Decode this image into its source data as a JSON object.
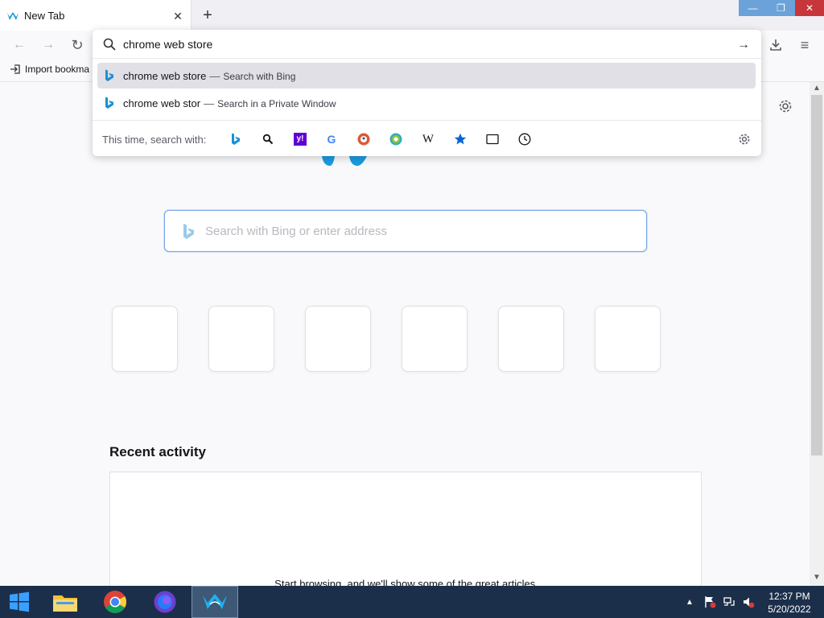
{
  "window": {
    "tab_title": "New Tab",
    "tab_close": "✕",
    "new_tab": "+",
    "minimize": "—",
    "maximize": "❐",
    "close": "✕"
  },
  "toolbar": {
    "back": "←",
    "forward": "→",
    "reload": "↻",
    "downloads": "download-icon",
    "menu": "≡"
  },
  "bookmarks": {
    "import_label": "Import bookma"
  },
  "urlbar": {
    "value": "chrome web store",
    "go": "→",
    "suggestions": [
      {
        "text": "chrome web store",
        "sep": "—",
        "action": "Search with Bing",
        "selected": true
      },
      {
        "text": "chrome web stor",
        "sep": "—",
        "action": "Search in a Private Window",
        "selected": false
      }
    ],
    "one_off_label": "This time, search with:",
    "engines": [
      "bing-icon",
      "search-icon",
      "yahoo-icon",
      "google-icon",
      "duckduckgo-icon",
      "ecosia-icon",
      "wikipedia-icon",
      "bookmarks-icon",
      "tabs-icon",
      "history-icon"
    ],
    "yahoo_text": "y!",
    "google_text": "G",
    "wikipedia_text": "W"
  },
  "content": {
    "search_placeholder": "Search with Bing or enter address",
    "recent_title": "Recent activity",
    "recent_message": "Start browsing, and we'll show some of the great articles,"
  },
  "taskbar": {
    "time": "12:37 PM",
    "date": "5/20/2022",
    "tray_up": "▲"
  },
  "colors": {
    "accent": "#0a84ff",
    "bing": "#1b8fd6",
    "taskbar": "#1c2f4a",
    "close_red": "#c7363a"
  }
}
